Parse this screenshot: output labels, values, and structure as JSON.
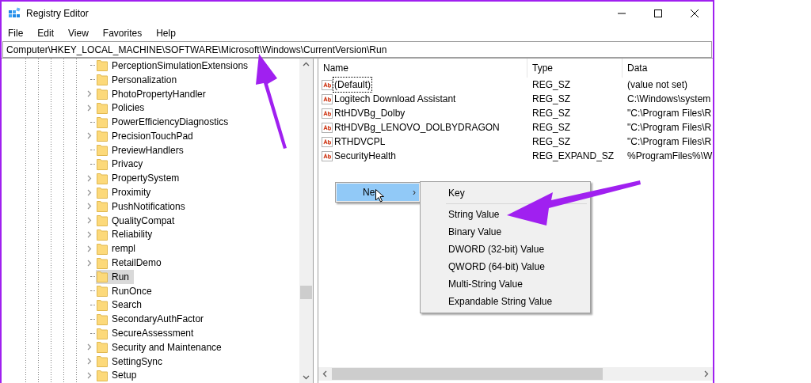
{
  "window": {
    "title": "Registry Editor"
  },
  "menu": [
    "File",
    "Edit",
    "View",
    "Favorites",
    "Help"
  ],
  "address": "Computer\\HKEY_LOCAL_MACHINE\\SOFTWARE\\Microsoft\\Windows\\CurrentVersion\\Run",
  "tree": [
    {
      "label": "PerceptionSimulationExtensions",
      "expandable": false,
      "selected": false
    },
    {
      "label": "Personalization",
      "expandable": false,
      "selected": false
    },
    {
      "label": "PhotoPropertyHandler",
      "expandable": true,
      "selected": false
    },
    {
      "label": "Policies",
      "expandable": true,
      "selected": false
    },
    {
      "label": "PowerEfficiencyDiagnostics",
      "expandable": false,
      "selected": false
    },
    {
      "label": "PrecisionTouchPad",
      "expandable": true,
      "selected": false
    },
    {
      "label": "PreviewHandlers",
      "expandable": false,
      "selected": false
    },
    {
      "label": "Privacy",
      "expandable": false,
      "selected": false
    },
    {
      "label": "PropertySystem",
      "expandable": true,
      "selected": false
    },
    {
      "label": "Proximity",
      "expandable": true,
      "selected": false
    },
    {
      "label": "PushNotifications",
      "expandable": true,
      "selected": false
    },
    {
      "label": "QualityCompat",
      "expandable": true,
      "selected": false
    },
    {
      "label": "Reliability",
      "expandable": true,
      "selected": false
    },
    {
      "label": "rempl",
      "expandable": true,
      "selected": false
    },
    {
      "label": "RetailDemo",
      "expandable": true,
      "selected": false
    },
    {
      "label": "Run",
      "expandable": false,
      "selected": true
    },
    {
      "label": "RunOnce",
      "expandable": false,
      "selected": false
    },
    {
      "label": "Search",
      "expandable": false,
      "selected": false
    },
    {
      "label": "SecondaryAuthFactor",
      "expandable": false,
      "selected": false
    },
    {
      "label": "SecureAssessment",
      "expandable": false,
      "selected": false
    },
    {
      "label": "Security and Maintenance",
      "expandable": true,
      "selected": false
    },
    {
      "label": "SettingSync",
      "expandable": true,
      "selected": false
    },
    {
      "label": "Setup",
      "expandable": true,
      "selected": false
    }
  ],
  "values": {
    "columns": [
      "Name",
      "Type",
      "Data"
    ],
    "rows": [
      {
        "name": "(Default)",
        "type": "REG_SZ",
        "data": "(value not set)",
        "focused": true
      },
      {
        "name": "Logitech Download Assistant",
        "type": "REG_SZ",
        "data": "C:\\Windows\\system",
        "focused": false
      },
      {
        "name": "RtHDVBg_Dolby",
        "type": "REG_SZ",
        "data": "\"C:\\Program Files\\R",
        "focused": false
      },
      {
        "name": "RtHDVBg_LENOVO_DOLBYDRAGON",
        "type": "REG_SZ",
        "data": "\"C:\\Program Files\\R",
        "focused": false
      },
      {
        "name": "RTHDVCPL",
        "type": "REG_SZ",
        "data": "\"C:\\Program Files\\R",
        "focused": false
      },
      {
        "name": "SecurityHealth",
        "type": "REG_EXPAND_SZ",
        "data": "%ProgramFiles%\\W",
        "focused": false
      }
    ]
  },
  "context_menu": {
    "item": "Ne",
    "arrow": "›"
  },
  "submenu": [
    {
      "kind": "item",
      "label": "Key"
    },
    {
      "kind": "separator"
    },
    {
      "kind": "item",
      "label": "String Value"
    },
    {
      "kind": "item",
      "label": "Binary Value"
    },
    {
      "kind": "item",
      "label": "DWORD (32-bit) Value"
    },
    {
      "kind": "item",
      "label": "QWORD (64-bit) Value"
    },
    {
      "kind": "item",
      "label": "Multi-String Value"
    },
    {
      "kind": "item",
      "label": "Expandable String Value"
    }
  ]
}
